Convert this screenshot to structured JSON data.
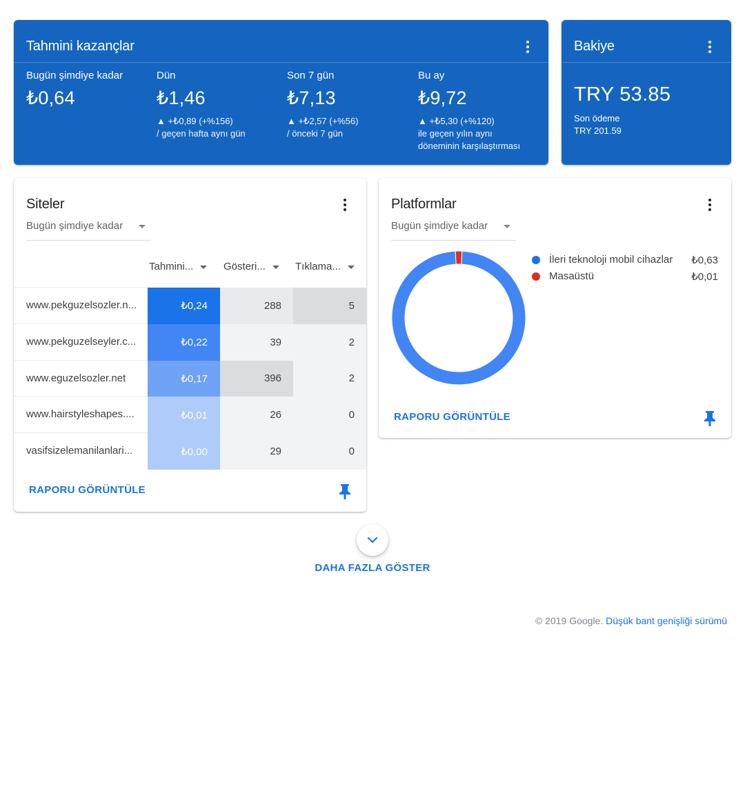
{
  "earnings": {
    "title": "Tahmini kazançlar",
    "metrics": [
      {
        "label": "Bugün şimdiye kadar",
        "value": "₺0,64",
        "change1": "",
        "change2": ""
      },
      {
        "label": "Dün",
        "value": "₺1,46",
        "change1": "▲ +₺0,89 (+%156)",
        "change2": "/ geçen hafta aynı gün",
        "change3": ""
      },
      {
        "label": "Son 7 gün",
        "value": "₺7,13",
        "change1": "▲ +₺2,57 (+%56)",
        "change2": "/ önceki 7 gün",
        "change3": ""
      },
      {
        "label": "Bu ay",
        "value": "₺9,72",
        "change1": "▲ +₺5,30 (+%120)",
        "change2": "ile geçen yılın aynı",
        "change3": "döneminin karşılaştırması"
      }
    ]
  },
  "balance": {
    "title": "Bakiye",
    "value": "TRY 53.85",
    "last_payment_label": "Son ödeme",
    "last_payment_value": "TRY 201.59"
  },
  "sites": {
    "title": "Siteler",
    "range": "Bugün şimdiye kadar",
    "columns": [
      "Tahmini...",
      "Gösteri...",
      "Tıklama..."
    ],
    "rows": [
      {
        "site": "www.pekguzelsozler.n...",
        "earnings": "₺0,24",
        "impressions": "288",
        "clicks": "5"
      },
      {
        "site": "www.pekguzelseyler.c...",
        "earnings": "₺0,22",
        "impressions": "39",
        "clicks": "2"
      },
      {
        "site": "www.eguzelsozler.net",
        "earnings": "₺0,17",
        "impressions": "396",
        "clicks": "2"
      },
      {
        "site": "www.hairstyleshapes....",
        "earnings": "₺0,01",
        "impressions": "26",
        "clicks": "0"
      },
      {
        "site": "vasifsizelemanilanlari...",
        "earnings": "₺0,00",
        "impressions": "29",
        "clicks": "0"
      }
    ],
    "heat": {
      "earnings": [
        "#1a73e8",
        "#4285f4",
        "#6fa2f4",
        "#aecbfa",
        "#aecbfa"
      ],
      "impressions": [
        "#e8eaed",
        "#f1f3f4",
        "#dadce0",
        "#f1f3f4",
        "#f1f3f4"
      ],
      "clicks": [
        "#dadce0",
        "#f1f3f4",
        "#f1f3f4",
        "#f1f3f4",
        "#f1f3f4"
      ]
    },
    "report_link": "RAPORU GÖRÜNTÜLE"
  },
  "platforms": {
    "title": "Platformlar",
    "range": "Bugün şimdiye kadar",
    "legend": [
      {
        "name": "İleri teknoloji mobil cihazlar",
        "amount": "₺0,63",
        "color": "#1a73e8"
      },
      {
        "name": "Masaüstü",
        "amount": "₺0,01",
        "color": "#d93025"
      }
    ],
    "chart_data": {
      "type": "pie",
      "categories": [
        "İleri teknoloji mobil cihazlar",
        "Masaüstü"
      ],
      "values": [
        0.63,
        0.01
      ],
      "colors": [
        "#4285f4",
        "#d93025"
      ]
    },
    "report_link": "RAPORU GÖRÜNTÜLE"
  },
  "more": {
    "label": "DAHA FAZLA GÖSTER"
  },
  "footer": {
    "copyright": "© 2019 Google.",
    "link": "Düşük bant genişliği sürümü"
  },
  "icons": {
    "menu": "more-vert-icon",
    "pin": "pin-icon",
    "expand": "chevron-down-icon"
  },
  "colors": {
    "brand_blue": "#1565c0",
    "link_blue": "#1a73e8"
  }
}
